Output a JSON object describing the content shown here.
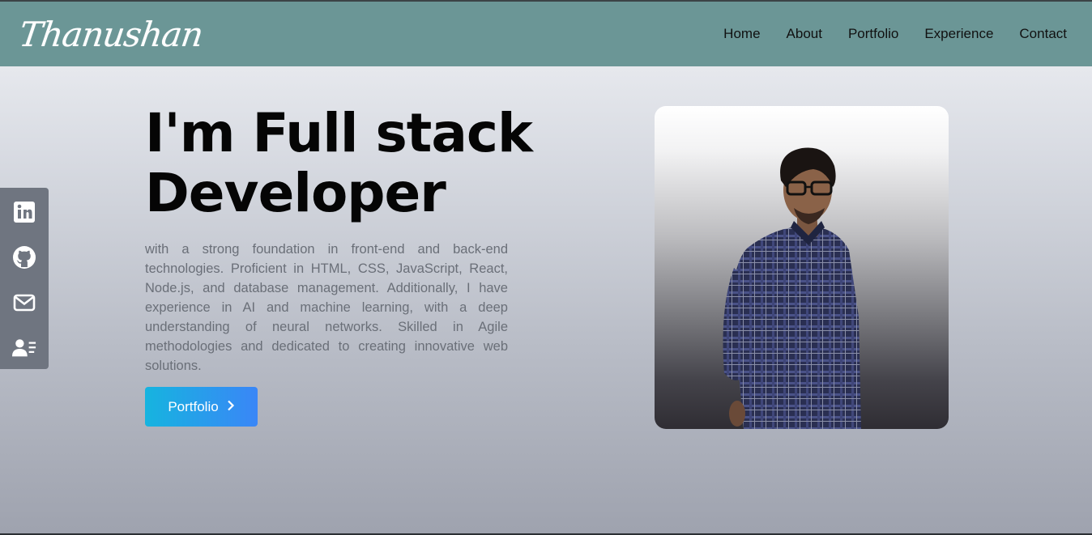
{
  "header": {
    "logo": "Thanushan",
    "nav": [
      "Home",
      "About",
      "Portfolio",
      "Experience",
      "Contact"
    ]
  },
  "hero": {
    "title_line1": "I'm Full stack",
    "title_line2": "Developer",
    "description": "with a strong foundation in front-end and back-end technologies. Proficient in HTML, CSS, JavaScript, React, Node.js, and database management. Additionally, I have experience in AI and machine learning, with a deep understanding of neural networks. Skilled in Agile methodologies and dedicated to creating innovative web solutions.",
    "button_label": "Portfolio"
  },
  "social": {
    "icons": [
      "linkedin-icon",
      "github-icon",
      "mail-icon",
      "resume-icon"
    ]
  },
  "colors": {
    "header_bg": "#6b9696",
    "sidebar_bg": "#6f7580",
    "button_start": "#16b4df",
    "button_end": "#3a86f7"
  }
}
